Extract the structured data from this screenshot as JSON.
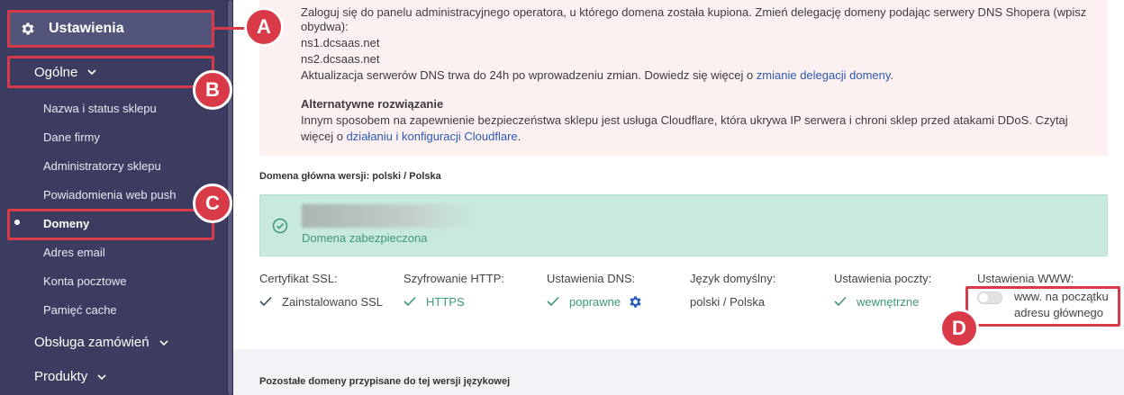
{
  "sidebar": {
    "settings_label": "Ustawienia",
    "general_label": "Ogólne",
    "items": [
      {
        "label": "Nazwa i status sklepu"
      },
      {
        "label": "Dane firmy"
      },
      {
        "label": "Administratorzy sklepu"
      },
      {
        "label": "Powiadomienia web push"
      },
      {
        "label": "Domeny",
        "active": true
      },
      {
        "label": "Adres email"
      },
      {
        "label": "Konta pocztowe"
      },
      {
        "label": "Pamięć cache"
      }
    ],
    "groups": [
      {
        "label": "Obsługa zamówień"
      },
      {
        "label": "Produkty"
      }
    ]
  },
  "annotations": {
    "a": "A",
    "b": "B",
    "c": "C",
    "d": "D"
  },
  "alert": {
    "line1": "Zaloguj się do panelu administracyjnego operatora, u którego domena została kupiona. Zmień delegację domeny podając serwery DNS Shopera (wpisz",
    "line2": "obydwa):",
    "ns1": "ns1.dcsaas.net",
    "ns2": "ns2.dcsaas.net",
    "update_text": "Aktualizacja serwerów DNS trwa do 24h po wprowadzeniu zmian. Dowiedz się więcej o ",
    "update_link": "zmianie delegacji domeny",
    "update_end": ".",
    "alt_title": "Alternatywne rozwiązanie",
    "alt_line1": "Innym sposobem na zapewnienie bezpieczeństwa sklepu jest usługa Cloudflare, która ukrywa IP serwera i chroni sklep przed atakami DDoS. Czytaj",
    "alt_line2_pre": "więcej o ",
    "alt_link": "działaniu i konfiguracji Cloudflare",
    "alt_line2_end": "."
  },
  "main_domain": {
    "label": "Domena główna wersji: polski / Polska",
    "status": "Domena zabezpieczona"
  },
  "settings_columns": [
    {
      "header": "Certyfikat SSL:",
      "value": "Zainstalowano SSL",
      "check": true
    },
    {
      "header": "Szyfrowanie HTTP:",
      "value": "HTTPS",
      "check": true
    },
    {
      "header": "Ustawienia DNS:",
      "value": "poprawne",
      "check": true
    },
    {
      "header": "Język domyślny:",
      "value": "polski / Polska",
      "check": false
    },
    {
      "header": "Ustawienia poczty:",
      "value": "wewnętrzne",
      "check": true
    },
    {
      "header": "Ustawienia WWW:",
      "toggle_line1": "www. na początku",
      "toggle_line2": "adresu głównego",
      "toggle_on": false
    }
  ],
  "other_domains": {
    "label": "Pozostałe domeny przypisane do tej wersji językowej"
  },
  "colors": {
    "sidebar_bg": "#3b3c60",
    "annotation_red": "#d93a47",
    "success_green": "#3d9a73",
    "link_blue": "#2b59b6",
    "alert_bg": "#fdf0f0"
  }
}
